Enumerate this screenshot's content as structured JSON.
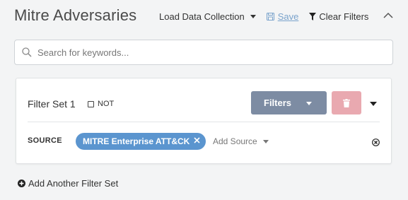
{
  "header": {
    "title": "Mitre Adversaries",
    "load_label": "Load Data Collection",
    "save_label": "Save",
    "clear_label": "Clear Filters"
  },
  "search": {
    "placeholder": "Search for keywords...",
    "value": ""
  },
  "filter_set": {
    "title": "Filter Set 1",
    "not_label": "NOT",
    "not_checked": false,
    "filters_button_label": "Filters",
    "source_label": "SOURCE",
    "source_chip": "MITRE Enterprise ATT&CK",
    "add_source_label": "Add Source"
  },
  "footer": {
    "add_filter_set_label": "Add Another Filter Set"
  },
  "colors": {
    "page_bg": "#f3f4f5",
    "filters_button": "#7d8ca3",
    "delete_button": "#e9a9b0",
    "chip": "#5b95cf",
    "save_link": "#7aa3cc"
  },
  "icons": {
    "search": "search-icon",
    "save": "save-icon",
    "filter": "filter-icon",
    "collapse": "chevron-up-icon",
    "delete": "trash-icon",
    "chip_remove": "close-icon",
    "row_remove": "circle-close-icon",
    "add": "plus-circle-icon"
  }
}
